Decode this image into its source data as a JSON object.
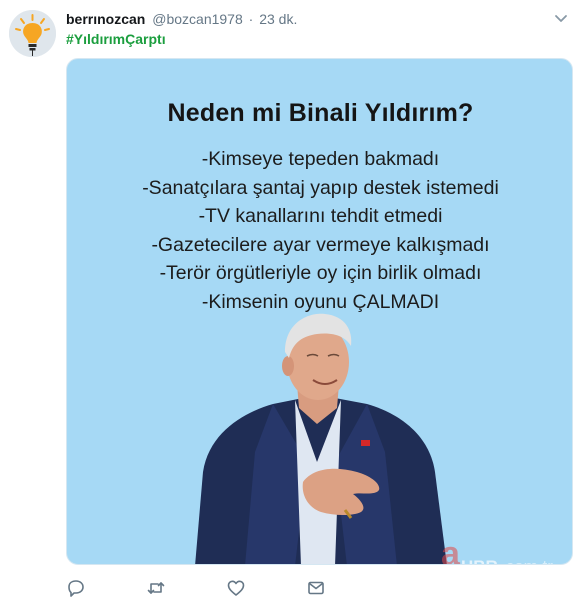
{
  "tweet": {
    "display_name": "berrınozcan",
    "handle": "@bozcan1978",
    "separator": "·",
    "time": "23 dk.",
    "hashtag": "#YıldırımÇarptı"
  },
  "card": {
    "title": "Neden mi Binali Yıldırım?",
    "lines": [
      "-Kimseye tepeden bakmadı",
      "-Sanatçılara şantaj yapıp destek istemedi",
      "-TV kanallarını tehdit etmedi",
      "-Gazetecilere ayar vermeye kalkışmadı",
      "-Terör örgütleriyle oy için birlik olmadı",
      "-Kimsenin oyunu ÇALMADI"
    ],
    "watermark": "a HBR.com.tr",
    "background": "#a6d9f5"
  },
  "icons": {
    "reply": "reply-icon",
    "retweet": "retweet-icon",
    "like": "heart-icon",
    "dm": "envelope-icon",
    "more": "chevron-down-icon"
  },
  "colors": {
    "hashtag": "#1b9e3e",
    "muted": "#657786",
    "icon": "#657786"
  }
}
